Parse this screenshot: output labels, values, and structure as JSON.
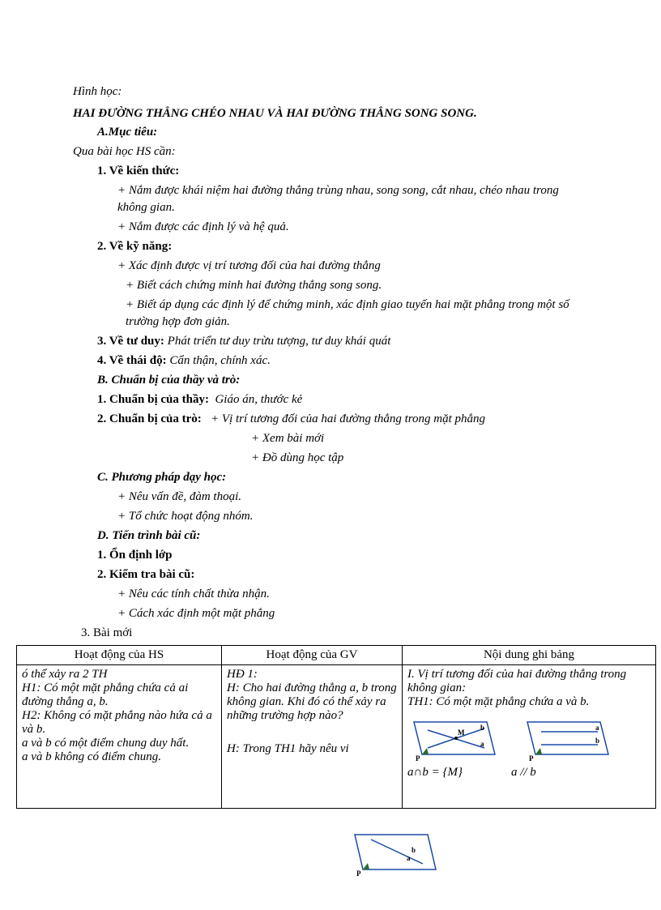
{
  "header": {
    "subject": "Hình học:",
    "title": "HAI ĐƯỜNG THẲNG CHÉO NHAU VÀ HAI ĐƯỜNG THẲNG SONG SONG."
  },
  "sectionA": {
    "heading": "A.Mục tiêu:",
    "intro": "Qua bài học HS cần:",
    "k1": {
      "h": "1. Về kiến thức:",
      "p1": "+ Nắm được khái niệm hai đường thẳng trùng nhau, song song, cắt nhau, chéo nhau trong không gian.",
      "p2": "+ Nắm được các định lý và hệ quả."
    },
    "k2": {
      "h": "2. Về kỹ năng:",
      "p1": "+ Xác định được vị trí tương đối của hai đường thẳng",
      "p2": "+ Biết cách chứng minh hai đường thẳng song song.",
      "p3": "+ Biết áp dụng các định lý để chứng minh, xác định giao tuyến hai mặt phẳng trong một số trường hợp đơn giản."
    },
    "k3": {
      "h": "3. Về tư duy:",
      "t": "Phát triển tư duy trừu tượng, tư duy khái quát"
    },
    "k4": {
      "h": "4. Về thái độ:",
      "t": "Cẩn thận, chính xác."
    }
  },
  "sectionB": {
    "heading": "B. Chuẩn bị của thầy và trò:",
    "p1h": "1. Chuẩn bị của thầy:",
    "p1t": "Giáo án, thước kẻ",
    "p2h": "2. Chuẩn bị của trò:",
    "p2a": "+ Vị trí tương đối của hai đường thẳng trong mặt phẳng",
    "p2b": "+ Xem bài mới",
    "p2c": "+ Đồ dùng học tập"
  },
  "sectionC": {
    "heading": "C.  Phương pháp dạy học:",
    "p1": "+ Nêu vấn đề, đàm thoại.",
    "p2": "+ Tổ chức hoạt động nhóm."
  },
  "sectionD": {
    "heading": "D.   Tiến trình bài cũ:",
    "d1": "1.   Ổn định lớp",
    "d2": "2.   Kiểm tra bài cũ:",
    "d2a": "+ Nêu các tính chất thừa nhận.",
    "d2b": "+ Cách xác định một mặt phẳng",
    "d3": "3. Bài mới"
  },
  "table": {
    "h1": "Hoạt động của HS",
    "h2": "Hoạt động của GV",
    "h3": "Nội dung ghi bảng",
    "c1": {
      "l1": "ó thể xảy ra 2 TH",
      "l2": "H1: Có một mặt phẳng chứa cả ai đường thẳng a, b.",
      "l3": "H2: Không có mặt phẳng nào hứa cả a và b.",
      "l4": "a và b có một điểm chung duy hất.",
      "l5": "a và b không có điểm chung."
    },
    "c2": {
      "l1": "HĐ 1:",
      "l2": "H: Cho hai đường thẳng a, b trong không gian. Khi đó có thể xảy ra những trường hợp nào?",
      "l3": "H: Trong TH1  hãy nêu vi"
    },
    "c3": {
      "l1": "I. Vị trí tương đối của hai đường thẳng trong không gian:",
      "l2": "TH1: Có một mặt phẳng chứa a và b.",
      "eq1": "a∩b = {M}",
      "eq2": "a // b"
    }
  },
  "diag": {
    "a": "a",
    "b": "b",
    "M": "M",
    "P": "P"
  }
}
